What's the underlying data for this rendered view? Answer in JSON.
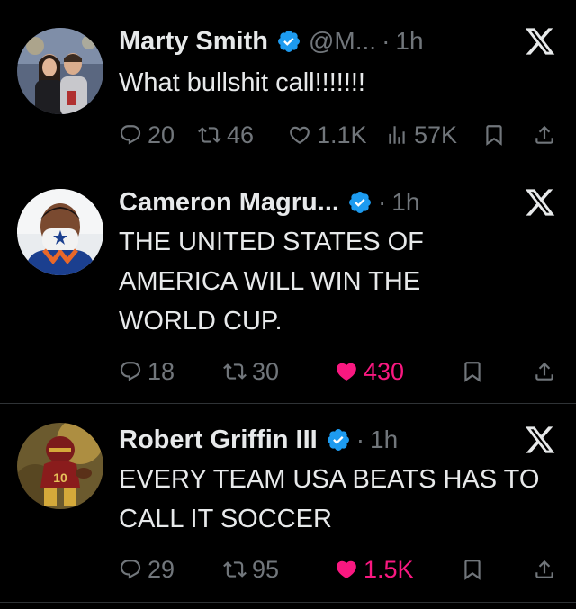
{
  "tweets": [
    {
      "name": "Marty Smith",
      "handle": "@M...",
      "sep": "·",
      "time": "1h",
      "text": "What bullshit call!!!!!!!",
      "replies": "20",
      "reposts": "46",
      "likes": "1.1K",
      "liked": false,
      "views": "57K"
    },
    {
      "name": "Cameron Magru...",
      "sep": "·",
      "time": "1h",
      "text": "THE UNITED STATES OF AMERICA WILL WIN THE WORLD CUP.",
      "replies": "18",
      "reposts": "30",
      "likes": "430",
      "liked": true
    },
    {
      "name": "Robert Griffin III",
      "sep": "·",
      "time": "1h",
      "text": "EVERY TEAM USA BEATS HAS TO CALL IT SOCCER",
      "replies": "29",
      "reposts": "95",
      "likes": "1.5K",
      "liked": true
    }
  ],
  "colors": {
    "background": "#000000",
    "text": "#e7e9ea",
    "muted": "#71767b",
    "verified": "#1d9bf0",
    "like": "#f91880",
    "divider": "#2f3336"
  },
  "icons": [
    "reply-icon",
    "repost-icon",
    "like-icon",
    "views-icon",
    "bookmark-icon",
    "share-icon",
    "verified-badge-icon",
    "x-logo-icon"
  ]
}
